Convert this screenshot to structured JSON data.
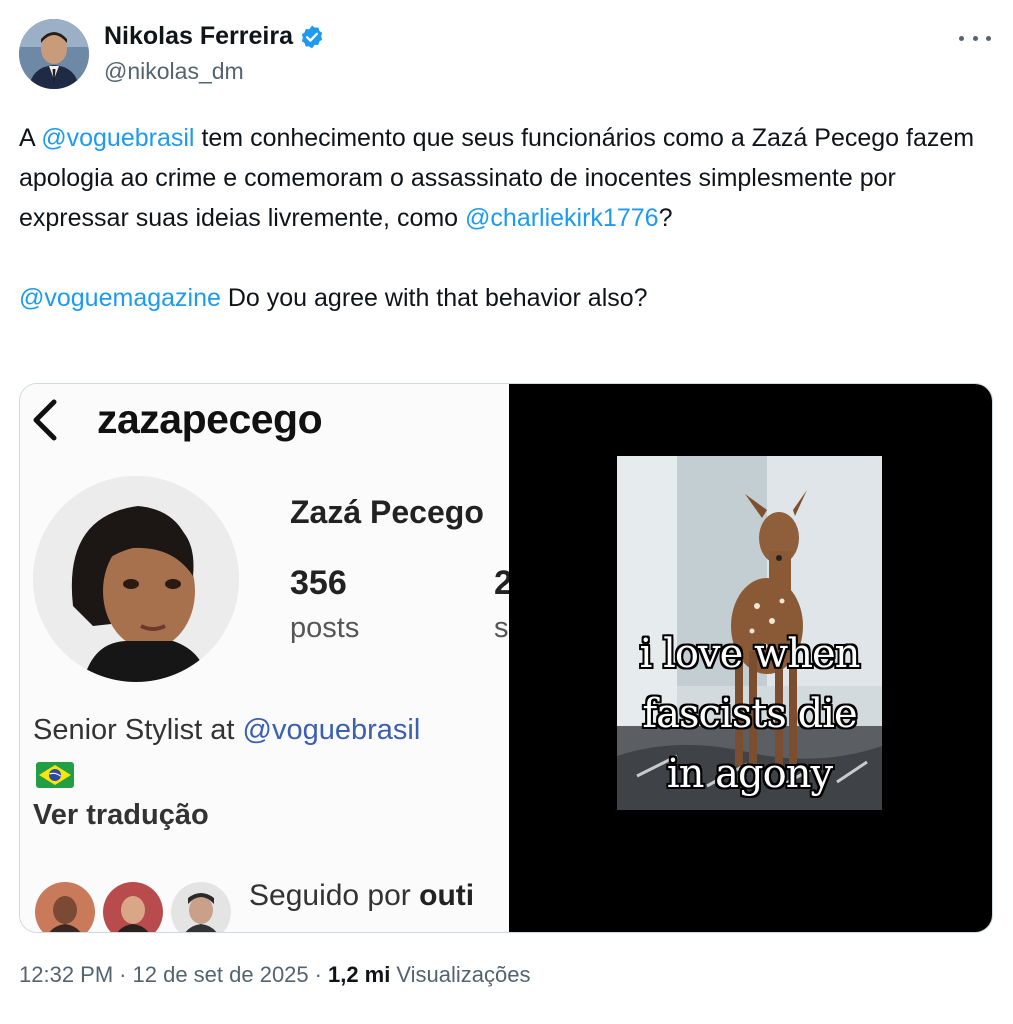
{
  "author": {
    "display_name": "Nikolas Ferreira",
    "handle": "@nikolas_dm",
    "verified": true,
    "verified_color": "#1d9bf0",
    "avatar_icon": "profile-photo"
  },
  "more_icon": "ellipsis-icon",
  "tweet": {
    "line1_prefix": "A ",
    "mention_vogue_brasil": "@voguebrasil",
    "line1_rest": " tem conhecimento que seus funcionários como a Zazá Pecego fazem apologia ao crime e comemoram o assassinato de inocentes simplesmente por expressar suas ideias livremente, como ",
    "mention_charlie": "@charliekirk1776",
    "line1_end": "?",
    "mention_vogue_magazine": "@voguemagazine",
    "line2_rest": " Do you agree with that behavior also?"
  },
  "media": {
    "instagram": {
      "username": "zazapecego",
      "full_name": "Zazá Pecego",
      "posts_count": "356",
      "posts_label": "posts",
      "cut_count": "2",
      "cut_label": "s",
      "bio_prefix": "Senior Stylist at ",
      "bio_link": "@voguebrasil",
      "flag_icon": "brazil-flag-icon",
      "translate_label": "Ver tradução",
      "followed_prefix": "Seguido por ",
      "followed_bold": "outi"
    },
    "meme": {
      "caption_lines": [
        "i love when",
        "fascists die",
        "in agony"
      ]
    }
  },
  "footer": {
    "time": "12:32 PM",
    "sep1": "·",
    "date": "12 de set de 2025",
    "sep2": "·",
    "views_count": "1,2 mi",
    "views_label": "Visualizações"
  },
  "colors": {
    "link": "#1d9bf0",
    "text": "#0f1419",
    "secondary": "#536471",
    "border": "#cfd9de"
  }
}
